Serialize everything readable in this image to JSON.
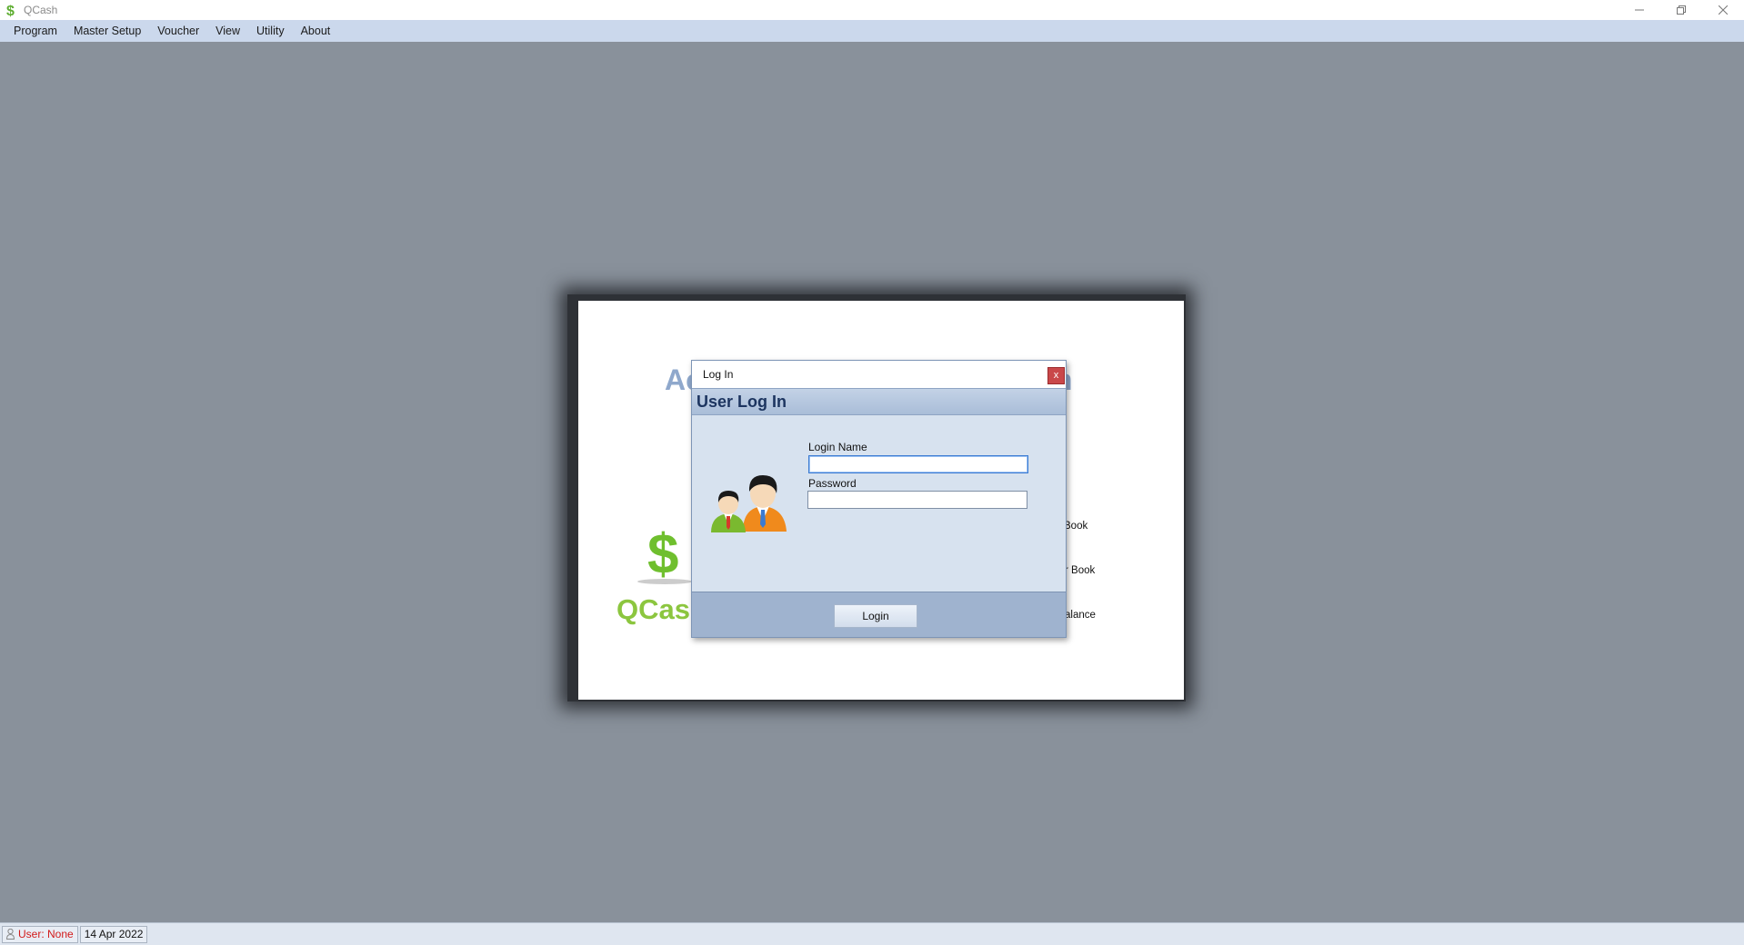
{
  "app": {
    "title": "QCash",
    "icon": "dollar-icon",
    "window_controls": [
      "minimize-icon",
      "restore-icon",
      "close-icon"
    ]
  },
  "menu": {
    "items": [
      "Program",
      "Master Setup",
      "Voucher",
      "View",
      "Utility",
      "About"
    ]
  },
  "splash": {
    "heading_left": "Ac",
    "heading_right": "m",
    "brand": "QCas",
    "links": [
      "Book",
      "r Book",
      "alance"
    ],
    "colors": {
      "heading": "#8fa8cc",
      "brand": "#8cc63f"
    }
  },
  "login_dialog": {
    "window_title": "Log In",
    "close_label": "x",
    "heading": "User Log In",
    "icon": "users-icon",
    "login_name_label": "Login Name",
    "login_name_value": "",
    "password_label": "Password",
    "password_value": "",
    "login_button": "Login"
  },
  "status": {
    "user": "User: None",
    "date": "14 Apr 2022"
  }
}
